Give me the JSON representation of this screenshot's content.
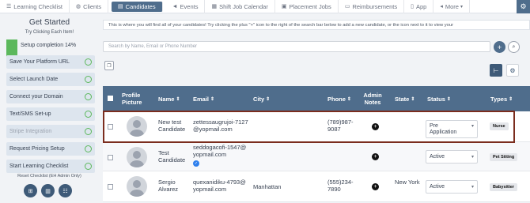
{
  "nav": {
    "items": [
      {
        "label": "Learning Checklist",
        "icon": "list-icon"
      },
      {
        "label": "Clients",
        "icon": "globe-icon"
      },
      {
        "label": "Candidates",
        "icon": "id-card-icon",
        "active": true
      },
      {
        "label": "Events",
        "icon": "megaphone-icon"
      },
      {
        "label": "Shift Job Calendar",
        "icon": "calendar-icon"
      },
      {
        "label": "Placement Jobs",
        "icon": "briefcase-icon"
      },
      {
        "label": "Reimbursements",
        "icon": "receipt-icon"
      },
      {
        "label": "App",
        "icon": "phone-icon"
      },
      {
        "label": "More",
        "icon": "chevron-down-icon"
      }
    ]
  },
  "sidebar": {
    "title": "Get Started",
    "subtitle": "Try Clicking Each Item!",
    "progress_label": "Setup completion 14%",
    "progress_value": 0.14,
    "steps": [
      {
        "label": "Save Your Platform URL",
        "done": false
      },
      {
        "label": "Select Launch Date",
        "done": false
      },
      {
        "label": "Connect your Domain",
        "done": false
      },
      {
        "label": "Text/SMS Set-up",
        "done": false
      },
      {
        "label": "Stripe Integration",
        "done": true
      },
      {
        "label": "Request Pricing Setup",
        "done": false
      },
      {
        "label": "Start Learning Checklist",
        "done": false
      }
    ],
    "reset_label": "Reset Checklist (EH Admin Only)"
  },
  "main": {
    "info_text": "This is where you will find all of your candidates! Try clicking the plus \"+\" icon to the right of the search bar below to add a new candidate, or the icon next to it to view your",
    "search_placeholder": "Search by Name, Email or Phone Number"
  },
  "table": {
    "headers": {
      "profile": "Profile Picture",
      "name": "Name",
      "email": "Email",
      "city": "City",
      "phone": "Phone",
      "admin_notes": "Admin Notes",
      "state": "State",
      "status": "Status",
      "types": "Types"
    },
    "rows": [
      {
        "name": "New test Candidate",
        "email": "zettessaugrujoi-7127@yopmail.com",
        "city": "",
        "phone": "(789)987-9087",
        "state": "",
        "status": "Pre Application",
        "type": "Nurse",
        "verified": false
      },
      {
        "name": "Test Candidate",
        "email": "seddogacofi-1547@yopmail.com",
        "city": "",
        "phone": "",
        "state": "",
        "status": "Active",
        "type": "Pet Sitting",
        "verified": true
      },
      {
        "name": "Sergio Alvarez",
        "email": "quexanidiku-4793@yopmail.com",
        "city": "Manhattan",
        "phone": "(555)234-7890",
        "state": "New York",
        "status": "Active",
        "type": "Babysitter",
        "verified": false
      }
    ]
  }
}
